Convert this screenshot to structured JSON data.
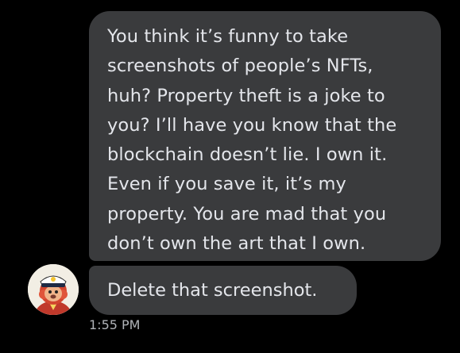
{
  "messages": [
    {
      "lines": [
        "You think it’s funny to take",
        "screenshots of people’s NFTs,",
        "huh? Property theft is a joke to",
        "you? I’ll have you know that the",
        "blockchain doesn’t lie. I own it.",
        "Even if you save it, it’s my",
        "property. You are mad that you",
        "don’t own the art that I own."
      ]
    },
    {
      "text": "Delete that screenshot."
    }
  ],
  "sender": {
    "avatar_icon": "captain-cartoon-avatar"
  },
  "timestamp": "1:55 PM",
  "colors": {
    "background": "#000000",
    "bubble": "#3a3b3d",
    "text": "#e4e6eb",
    "timestamp": "#b0b3b8"
  }
}
